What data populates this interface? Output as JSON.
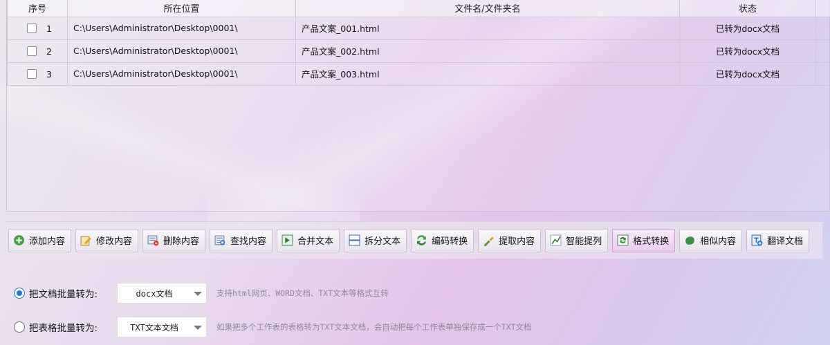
{
  "table": {
    "columns": [
      "序号",
      "所在位置",
      "文件名/文件夹名",
      "状态"
    ],
    "rows": [
      {
        "seq": "1",
        "path": "C:\\Users\\Administrator\\Desktop\\0001\\",
        "name": "产品文案_001.html",
        "status": "已转为docx文档"
      },
      {
        "seq": "2",
        "path": "C:\\Users\\Administrator\\Desktop\\0001\\",
        "name": "产品文案_002.html",
        "status": "已转为docx文档"
      },
      {
        "seq": "3",
        "path": "C:\\Users\\Administrator\\Desktop\\0001\\",
        "name": "产品文案_003.html",
        "status": "已转为docx文档"
      }
    ]
  },
  "toolbar": {
    "buttons": [
      {
        "label": "添加内容",
        "icon": "add-icon"
      },
      {
        "label": "修改内容",
        "icon": "edit-icon"
      },
      {
        "label": "删除内容",
        "icon": "delete-icon"
      },
      {
        "label": "查找内容",
        "icon": "find-icon"
      },
      {
        "label": "合并文本",
        "icon": "merge-icon"
      },
      {
        "label": "拆分文本",
        "icon": "split-icon"
      },
      {
        "label": "编码转换",
        "icon": "encode-icon"
      },
      {
        "label": "提取内容",
        "icon": "extract-icon"
      },
      {
        "label": "智能提列",
        "icon": "smart-column-icon"
      },
      {
        "label": "格式转换",
        "icon": "format-convert-icon",
        "active": true
      },
      {
        "label": "相似内容",
        "icon": "similar-icon"
      },
      {
        "label": "翻译文档",
        "icon": "translate-icon"
      }
    ]
  },
  "options": {
    "doc": {
      "label": "把文档批量转为:",
      "value": "docx文档",
      "hint": "支持html网页、WORD文档、TXT文本等格式互转",
      "selected": true
    },
    "sheet": {
      "label": "把表格批量转为:",
      "value": "TXT文本文档",
      "hint": "如果把多个工作表的表格转为TXT文本文档，会自动把每个工作表单独保存成一个TXT文档",
      "selected": false
    }
  },
  "colors": {
    "accent": "#1e78d6",
    "active_button": "#e9cdef"
  }
}
